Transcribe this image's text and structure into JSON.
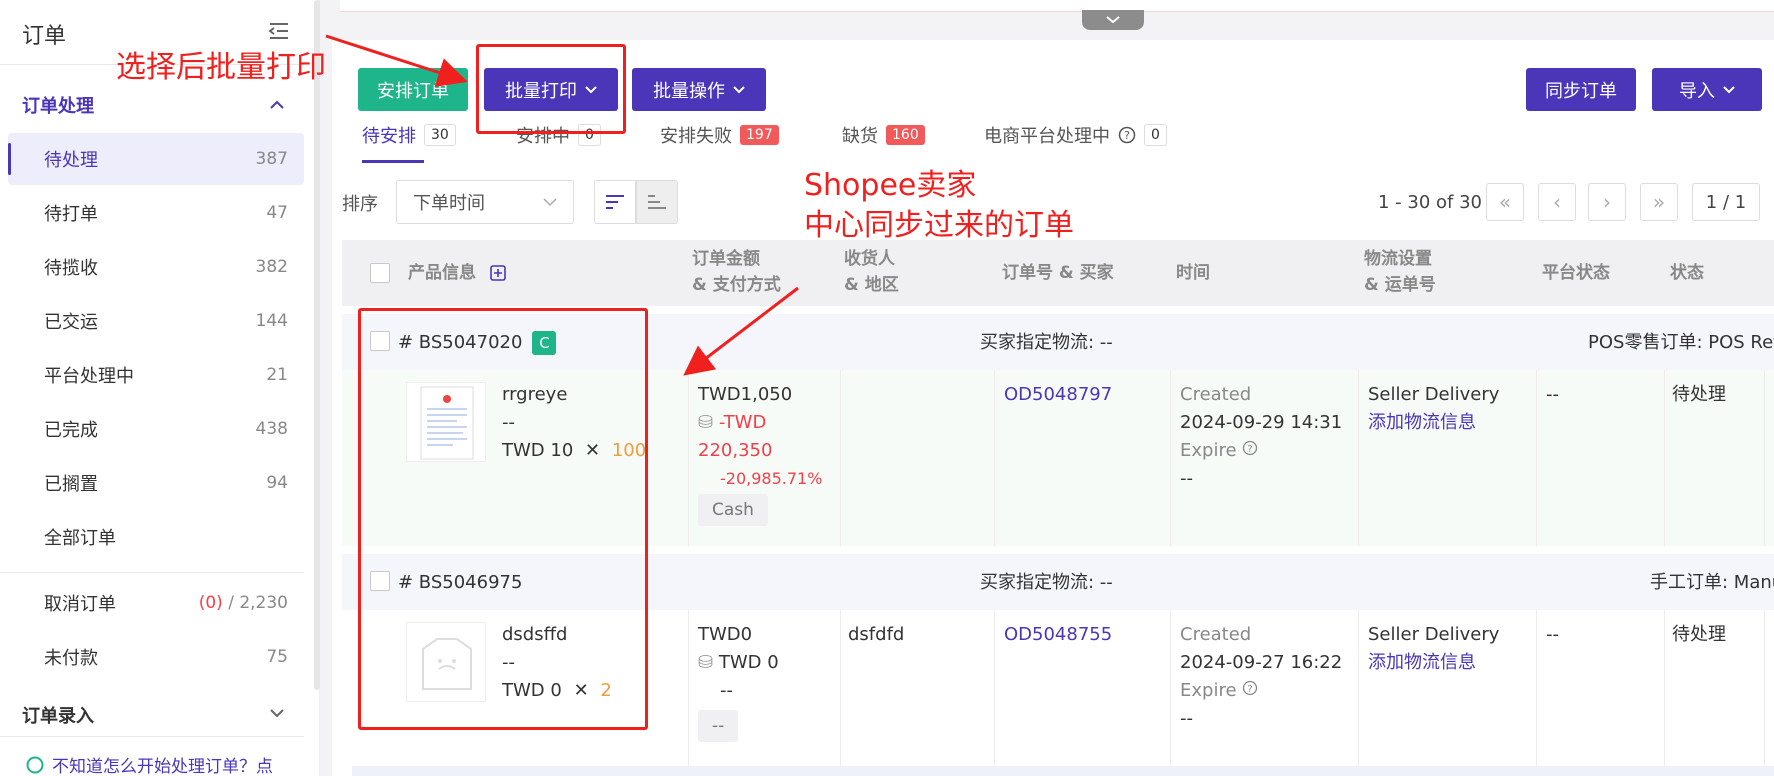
{
  "sidebar": {
    "title": "订单",
    "group1": "订单处理",
    "items": [
      {
        "label": "待处理",
        "count": "387"
      },
      {
        "label": "待打单",
        "count": "47"
      },
      {
        "label": "待揽收",
        "count": "382"
      },
      {
        "label": "已交运",
        "count": "144"
      },
      {
        "label": "平台处理中",
        "count": "21"
      },
      {
        "label": "已完成",
        "count": "438"
      },
      {
        "label": "已搁置",
        "count": "94"
      },
      {
        "label": "全部订单",
        "count": ""
      }
    ],
    "cancel": {
      "label": "取消订单",
      "count_red": "(0)",
      "count_total": " / 2,230"
    },
    "unpaid": {
      "label": "未付款",
      "count": "75"
    },
    "group2": "订单录入",
    "help_text": "不知道怎么开始处理订单？点"
  },
  "toolbar": {
    "arrange": "安排订单",
    "batch_print": "批量打印",
    "batch_ops": "批量操作",
    "sync": "同步订单",
    "import": "导入"
  },
  "tabs": [
    {
      "label": "待安排",
      "count": "30"
    },
    {
      "label": "安排中",
      "count": "0"
    },
    {
      "label": "安排失败",
      "count": "197"
    },
    {
      "label": "缺货",
      "count": "160"
    },
    {
      "label": "电商平台处理中",
      "count": "0"
    }
  ],
  "sort": {
    "label": "排序",
    "value": "下单时间"
  },
  "pager": {
    "range": "1 - 30 of 30",
    "page": "1 / 1"
  },
  "table": {
    "headers": {
      "product": "产品信息",
      "amount_1": "订单金额",
      "amount_2": "& 支付方式",
      "receiver_1": "收货人",
      "receiver_2": "& 地区",
      "order_no": "订单号 & 买家",
      "time": "时间",
      "logistics_1": "物流设置",
      "logistics_2": "& 运单号",
      "platform": "平台状态",
      "status": "状态"
    },
    "orders": [
      {
        "id": "# BS5047020",
        "badge": "C",
        "buyer_logistics": "买家指定物流: --",
        "source": "POS零售订单: POS Ret",
        "product_name": "rrgreye",
        "product_sku": "--",
        "unit_price": "TWD 10",
        "qty": "100",
        "amount": "TWD1,050",
        "pay_amount_1": "-TWD",
        "pay_amount_2": "220,350",
        "pay_pct": "-20,985.71%",
        "pay_method": "Cash",
        "receiver": "",
        "order_no": "OD5048797",
        "created_label": "Created",
        "created_time": "2024-09-29 14:31",
        "expire_label": "Expire",
        "expire_value": "--",
        "logistics": "Seller Delivery",
        "add_logistics": "添加物流信息",
        "platform_status": "--",
        "status": "待处理"
      },
      {
        "id": "# BS5046975",
        "badge": "",
        "buyer_logistics": "买家指定物流: --",
        "source": "手工订单: Manu",
        "product_name": "dsdsffd",
        "product_sku": "--",
        "unit_price": "TWD 0",
        "qty": "2",
        "amount": "TWD0",
        "pay_amount_1": "TWD 0",
        "pay_amount_2": "--",
        "pay_pct": "",
        "pay_method": "--",
        "receiver": "dsfdfd",
        "order_no": "OD5048755",
        "created_label": "Created",
        "created_time": "2024-09-27 16:22",
        "expire_label": "Expire",
        "expire_value": "--",
        "logistics": "Seller Delivery",
        "add_logistics": "添加物流信息",
        "platform_status": "--",
        "status": "待处理"
      }
    ]
  },
  "annotations": {
    "batch_print_note": "选择后批量打印",
    "shopee_note_1": "Shopee卖家",
    "shopee_note_2": "中心同步过来的订单"
  },
  "colors": {
    "primary": "#4b35b8",
    "green": "#1fb58a",
    "red": "#f05a5a",
    "annotation": "#f0201e"
  }
}
